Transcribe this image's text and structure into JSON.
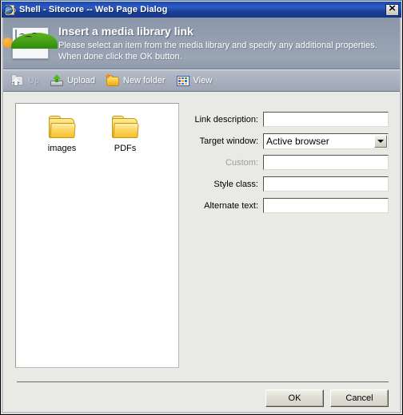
{
  "window": {
    "title": "Shell - Sitecore -- Web Page Dialog",
    "icon": "ie-document-icon",
    "close_label": "✕"
  },
  "header": {
    "icon": "media-picture-icon",
    "title": "Insert a media library link",
    "subtitle_line1": "Please select an item from the media library and specify any additional properties.",
    "subtitle_line2": "When done click the OK button."
  },
  "toolbar": {
    "items": [
      {
        "label": "Up",
        "icon": "folder-up-icon",
        "disabled": true
      },
      {
        "label": "Upload",
        "icon": "upload-icon",
        "disabled": false
      },
      {
        "label": "New folder",
        "icon": "new-folder-icon",
        "disabled": false
      },
      {
        "label": "View",
        "icon": "view-grid-icon",
        "disabled": false
      }
    ]
  },
  "file_panel": {
    "items": [
      {
        "label": "images",
        "icon": "folder-icon"
      },
      {
        "label": "PDFs",
        "icon": "folder-icon"
      }
    ]
  },
  "form": {
    "fields": [
      {
        "label": "Link description:",
        "type": "text",
        "value": "",
        "placeholder": "",
        "disabled": false
      },
      {
        "label": "Target window:",
        "type": "select",
        "value": "Active browser",
        "disabled": false
      },
      {
        "label": "Custom:",
        "type": "text",
        "value": "",
        "placeholder": "",
        "disabled": true
      },
      {
        "label": "Style class:",
        "type": "text",
        "value": "",
        "placeholder": "",
        "disabled": false
      },
      {
        "label": "Alternate text:",
        "type": "text",
        "value": "",
        "placeholder": "",
        "disabled": false
      }
    ]
  },
  "buttons": {
    "ok": "OK",
    "cancel": "Cancel"
  },
  "colors": {
    "titlebar": "#1f49a8",
    "header_gradient_top": "#8b97a9",
    "header_gradient_bottom": "#8e99ab",
    "toolbar": "#aab1bf",
    "dialog_bg": "#e9e9e6",
    "folder_yellow": "#f7c43b",
    "upload_green": "#4fbc1f"
  }
}
